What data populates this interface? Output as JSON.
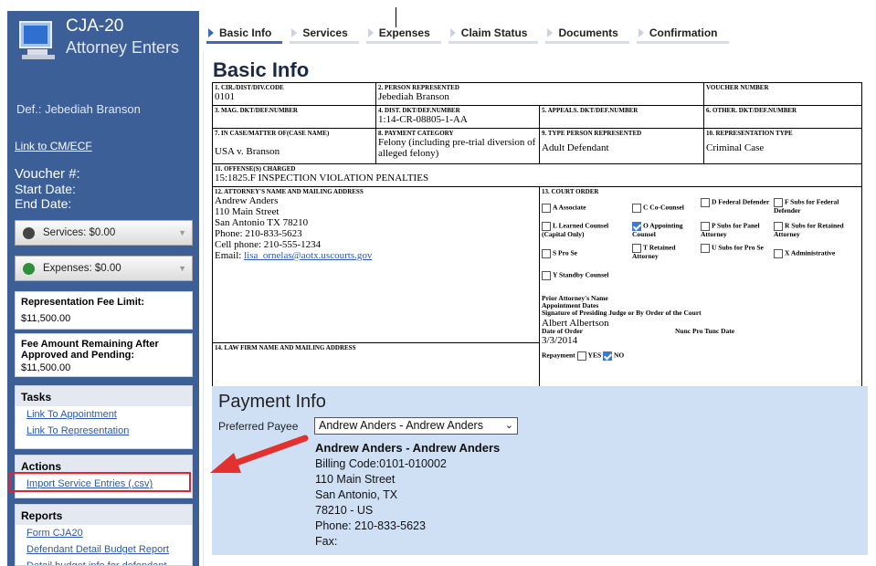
{
  "app": {
    "title": "CJA-20",
    "subtitle": "Attorney Enters"
  },
  "sidebar": {
    "defendant": "Def.: Jebediah Branson",
    "cm_link": "Link to CM/ECF",
    "voucher": "Voucher #:",
    "start_date": "Start Date:",
    "end_date": "End Date:",
    "services": "Services: $0.00",
    "expenses": "Expenses: $0.00",
    "rep_fee_limit_label": "Representation Fee Limit:",
    "rep_fee_limit_value": "$11,500.00",
    "fee_remaining_label": "Fee Amount Remaining After Approved and Pending:",
    "fee_remaining_value": "$11,500.00",
    "tasks_title": "Tasks",
    "tasks": [
      "Link To Appointment",
      "Link To Representation"
    ],
    "actions_title": "Actions",
    "actions": [
      "Import Service Entries (.csv)"
    ],
    "reports_title": "Reports",
    "reports": [
      "Form CJA20",
      "Defendant Detail Budget Report",
      "Detail budget info for defendant"
    ]
  },
  "tabs": [
    "Basic Info",
    "Services",
    "Expenses",
    "Claim Status",
    "Documents",
    "Confirmation"
  ],
  "page_title": "Basic Info",
  "form": {
    "f1_label": "1. CIR./DIST/DIV.CODE",
    "f1_value": "0101",
    "f2_label": "2. PERSON REPRESENTED",
    "f2_value": "Jebediah Branson",
    "voucher_label": "VOUCHER NUMBER",
    "f3_label": "3. MAG. DKT/DEF.NUMBER",
    "f4_label": "4. DIST. DKT/DEF.NUMBER",
    "f4_value": "1:14-CR-08805-1-AA",
    "f5_label": "5. APPEALS. DKT/DEF.NUMBER",
    "f6_label": "6. OTHER. DKT/DEF.NUMBER",
    "f7_label": "7. IN CASE/MATTER OF(Case Name)",
    "f7_value": "USA v. Branson",
    "f8_label": "8. PAYMENT CATEGORY",
    "f8_value": "Felony (including pre-trial diversion of alleged felony)",
    "f9_label": "9. TYPE PERSON REPRESENTED",
    "f9_value": "Adult Defendant",
    "f10_label": "10. REPRESENTATION TYPE",
    "f10_value": "Criminal Case",
    "f11_label": "11. OFFENSE(S) CHARGED",
    "f11_value": "15:1825.F INSPECTION VIOLATION PENALTIES",
    "f12_label": "12. ATTORNEY'S NAME AND MAILING ADDRESS",
    "f12_lines": [
      "Andrew Anders",
      "110 Main Street",
      "San Antonio TX 78210",
      "Phone: 210-833-5623",
      "Cell phone: 210-555-1234"
    ],
    "f12_email_label": "Email:",
    "f12_email": "lisa_ornelas@aotx.uscourts.gov",
    "f13_label": "13. COURT ORDER",
    "court_options": [
      "A Associate",
      "C Co-Counsel",
      "D Federal Defender",
      "F Subs for Federal Defender",
      "L Learned Counsel (Capital Only)",
      "O Appointing Counsel",
      "P Subs for Panel Attorney",
      "R Subs for Retained Attorney",
      "S Pro Se",
      "T Retained Attorney",
      "U Subs for Pro Se",
      "X Administrative",
      "Y Standby Counsel"
    ],
    "prior_attorney": "Prior Attorney's Name",
    "appointment_dates": "Appointment Dates",
    "signature": "Signature of Presiding Judge or By Order of the Court",
    "judge": "Albert Albertson",
    "date_of_order_label": "Date of Order",
    "nunc": "Nunc Pro Tunc Date",
    "date_of_order": "3/3/2014",
    "repayment": "Repayment",
    "yes": "YES",
    "no": "NO",
    "f14_label": "14. LAW FIRM NAME AND MAILING ADDRESS"
  },
  "payment": {
    "title": "Payment Info",
    "preferred_payee_label": "Preferred Payee",
    "selected": "Andrew Anders - Andrew Anders",
    "name": "Andrew Anders - Andrew Anders",
    "lines": [
      "Billing Code:0101-010002",
      "110 Main Street",
      "San Antonio, TX",
      "78210 - US",
      "Phone: 210-833-5623",
      "Fax:"
    ]
  },
  "colors": {
    "sidebar": "#3c5f97",
    "accent": "#3c68c4",
    "highlight": "#e0262b",
    "payment_bg": "#cfe0f4"
  }
}
